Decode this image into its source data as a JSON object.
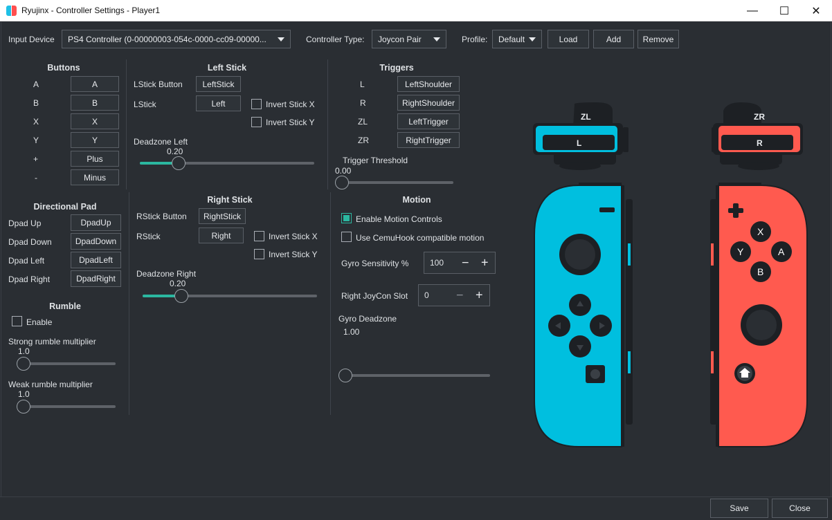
{
  "window": {
    "title": "Ryujinx - Controller Settings - Player1",
    "minimize": "—",
    "maximize": "☐",
    "close": "✕"
  },
  "toolbar": {
    "input_device_label": "Input Device",
    "input_device_value": "PS4 Controller (0-00000003-054c-0000-cc09-00000...",
    "controller_type_label": "Controller Type:",
    "controller_type_value": "Joycon Pair",
    "profile_label": "Profile:",
    "profile_value": "Default",
    "load": "Load",
    "add": "Add",
    "remove": "Remove"
  },
  "buttons": {
    "header": "Buttons",
    "rows": [
      {
        "label": "A",
        "value": "A"
      },
      {
        "label": "B",
        "value": "B"
      },
      {
        "label": "X",
        "value": "X"
      },
      {
        "label": "Y",
        "value": "Y"
      },
      {
        "label": "+",
        "value": "Plus"
      },
      {
        "label": "-",
        "value": "Minus"
      }
    ]
  },
  "left_stick": {
    "header": "Left Stick",
    "button_label": "LStick Button",
    "button_value": "LeftStick",
    "stick_label": "LStick",
    "stick_value": "Left",
    "invert_x": "Invert Stick X",
    "invert_y": "Invert Stick Y",
    "deadzone_label": "Deadzone Left",
    "deadzone_value": "0.20",
    "deadzone_fraction": 0.2
  },
  "triggers": {
    "header": "Triggers",
    "rows": [
      {
        "label": "L",
        "value": "LeftShoulder"
      },
      {
        "label": "R",
        "value": "RightShoulder"
      },
      {
        "label": "ZL",
        "value": "LeftTrigger"
      },
      {
        "label": "ZR",
        "value": "RightTrigger"
      }
    ],
    "threshold_label": "Trigger Threshold",
    "threshold_value": "0.00",
    "threshold_fraction": 0.0
  },
  "dpad": {
    "header": "Directional Pad",
    "rows": [
      {
        "label": "Dpad Up",
        "value": "DpadUp"
      },
      {
        "label": "Dpad Down",
        "value": "DpadDown"
      },
      {
        "label": "Dpad Left",
        "value": "DpadLeft"
      },
      {
        "label": "Dpad Right",
        "value": "DpadRight"
      }
    ]
  },
  "right_stick": {
    "header": "Right Stick",
    "button_label": "RStick Button",
    "button_value": "RightStick",
    "stick_label": "RStick",
    "stick_value": "Right",
    "invert_x": "Invert Stick X",
    "invert_y": "Invert Stick Y",
    "deadzone_label": "Deadzone Right",
    "deadzone_value": "0.20",
    "deadzone_fraction": 0.2
  },
  "motion": {
    "header": "Motion",
    "enable_label": "Enable Motion Controls",
    "enable_checked": true,
    "cemuhook_label": "Use CemuHook compatible motion",
    "cemuhook_checked": false,
    "gyro_sens_label": "Gyro Sensitivity %",
    "gyro_sens_value": "100",
    "slot_label": "Right JoyCon Slot",
    "slot_value": "0",
    "gyro_deadzone_label": "Gyro Deadzone",
    "gyro_deadzone_value": "1.00",
    "gyro_deadzone_fraction": 0.0
  },
  "rumble": {
    "header": "Rumble",
    "enable_label": "Enable",
    "enable_checked": false,
    "strong_label": "Strong rumble multiplier",
    "strong_value": "1.0",
    "strong_fraction": 0.0,
    "weak_label": "Weak rumble multiplier",
    "weak_value": "1.0",
    "weak_fraction": 0.0
  },
  "joycon_image": {
    "left_color": "#00bfdf",
    "right_color": "#ff5a4f",
    "zl": "ZL",
    "l": "L",
    "zr": "ZR",
    "r": "R",
    "face_buttons": {
      "x": "X",
      "y": "Y",
      "a": "A",
      "b": "B"
    }
  },
  "footer": {
    "save": "Save",
    "close": "Close"
  },
  "colors": {
    "background": "#2a2e33",
    "accent": "#2bb7a0",
    "border": "#5a5f66"
  }
}
